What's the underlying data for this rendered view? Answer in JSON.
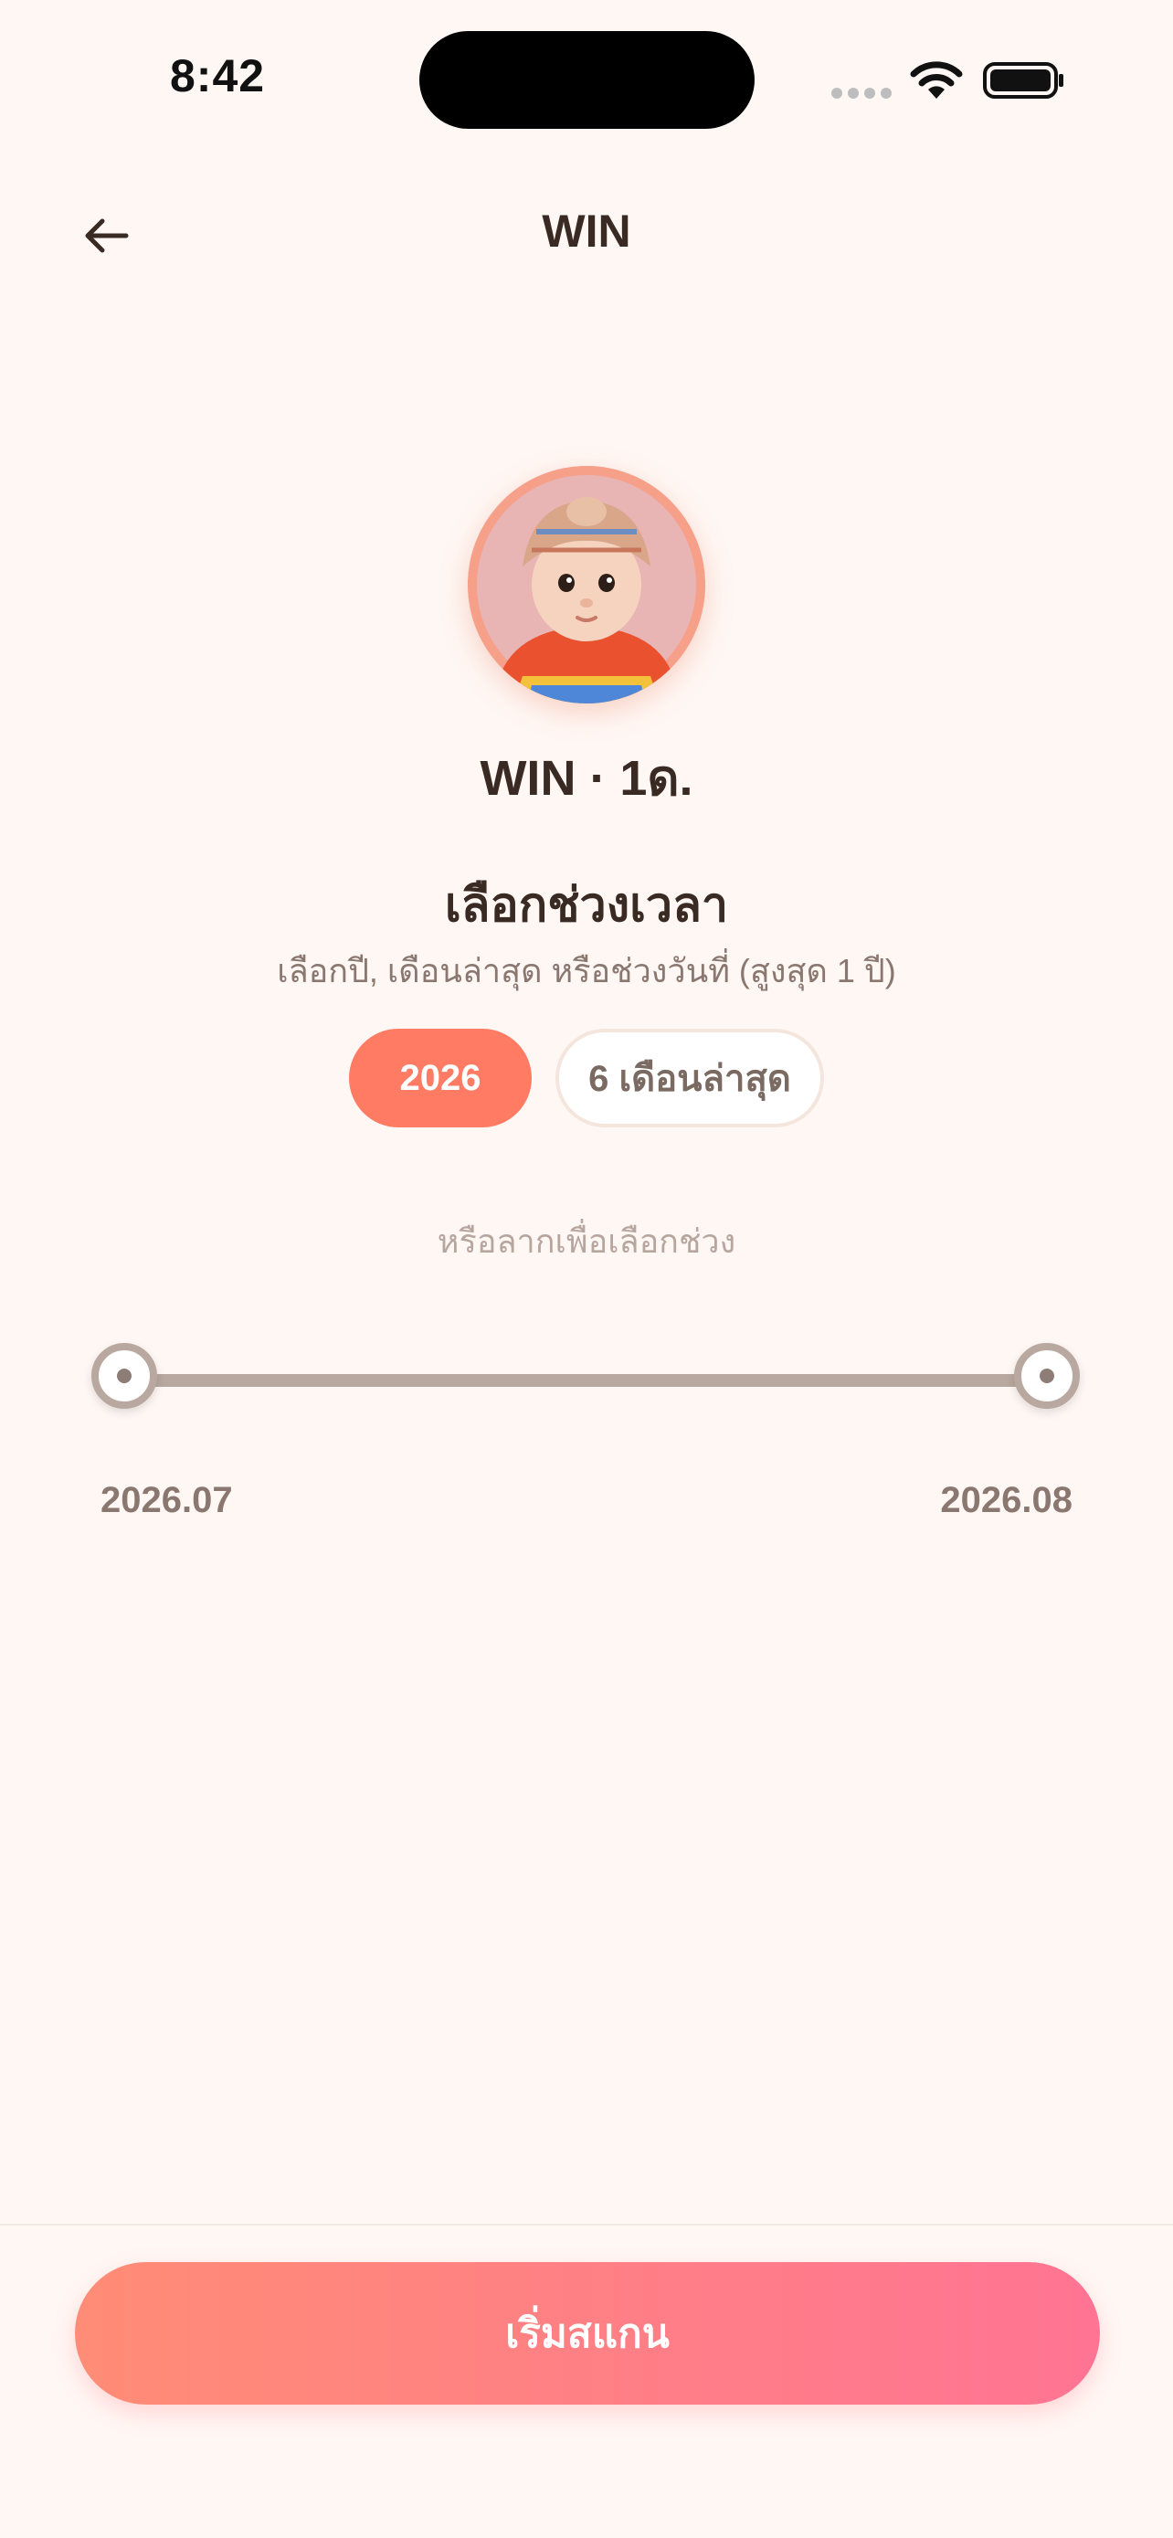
{
  "status_bar": {
    "time": "8:42"
  },
  "header": {
    "title": "WIN",
    "back_icon": "arrow-left-icon"
  },
  "profile": {
    "name_age": "WIN · 1ด."
  },
  "period_picker": {
    "title": "เลือกช่วงเวลา",
    "subtitle": "เลือกปี, เดือนล่าสุด หรือช่วงวันที่ (สูงสุด 1 ปี)",
    "chips": [
      {
        "label": "2026",
        "selected": true
      },
      {
        "label": "6 เดือนล่าสุด",
        "selected": false
      }
    ],
    "drag_hint": "หรือลากเพื่อเลือกช่วง"
  },
  "range_slider": {
    "start_label": "2026.07",
    "end_label": "2026.08"
  },
  "actions": {
    "start_scan": "เริ่มสแกน"
  },
  "colors": {
    "background": "#FFF7F4",
    "accent": "#FF7B63",
    "button_gradient_start": "#FF8C76",
    "button_gradient_end": "#FF7493",
    "text_primary": "#3A2A24",
    "text_secondary": "#8A7870"
  }
}
